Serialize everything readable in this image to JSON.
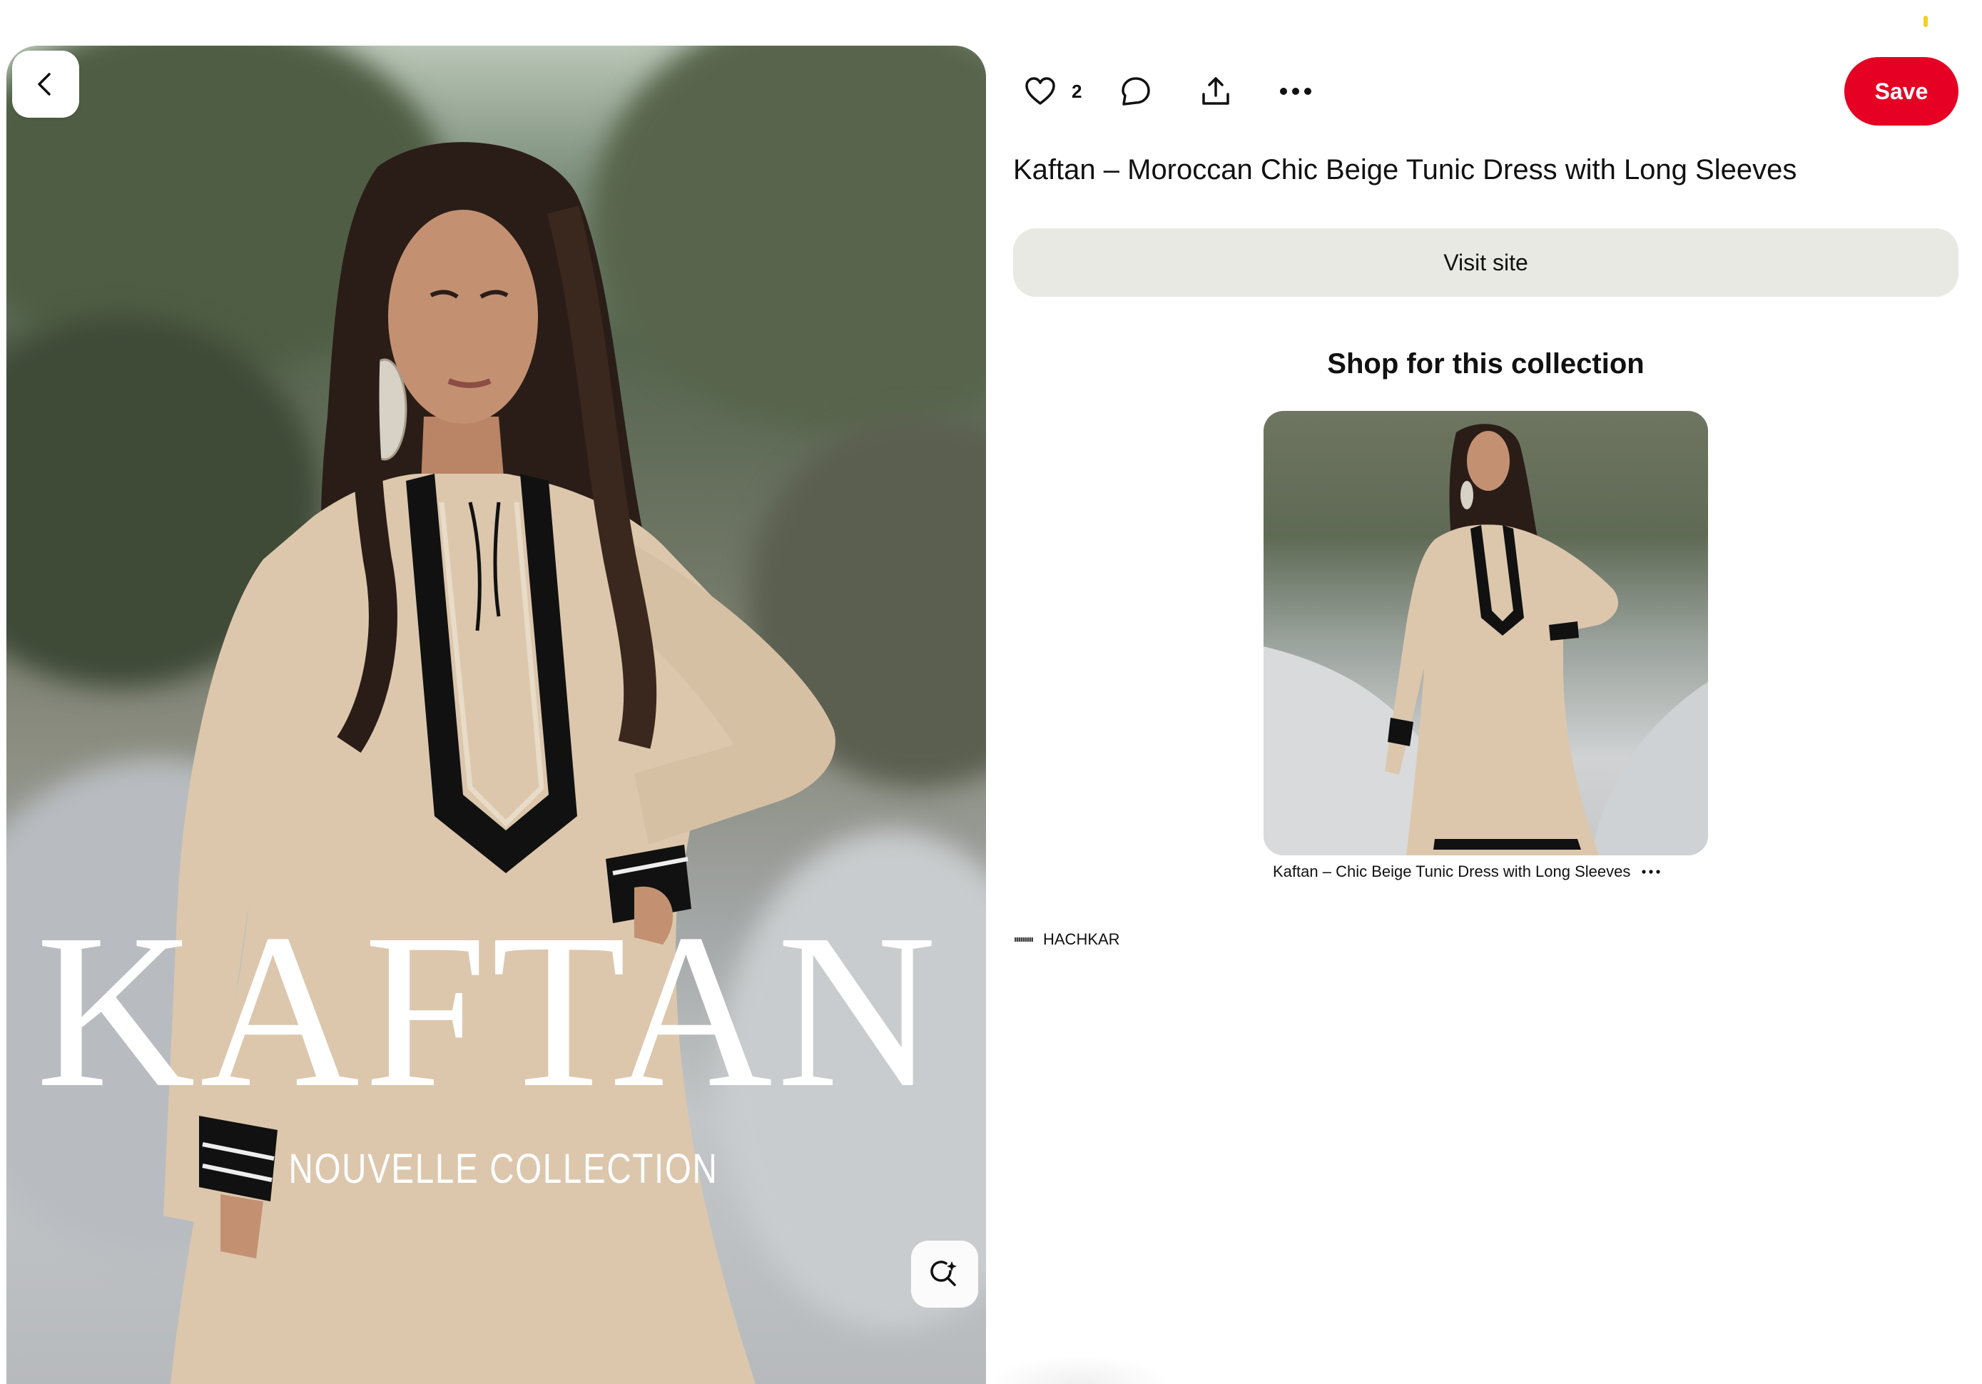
{
  "pin": {
    "overlay_title": "KAFTAN",
    "overlay_subtitle": "NOUVELLE COLLECTION",
    "title": "Kaftan – Moroccan Chic Beige Tunic Dress with Long Sleeves",
    "like_count": "2"
  },
  "actions": {
    "save_label": "Save",
    "visit_site_label": "Visit site"
  },
  "icons": {
    "back": "chevron-left-icon",
    "like": "heart-icon",
    "comment": "comment-icon",
    "share": "share-icon",
    "more": "more-icon",
    "visual_search": "visual-search-icon",
    "product_more": "more-icon"
  },
  "shop": {
    "heading": "Shop for this collection",
    "products": [
      {
        "title": "Kaftan – Chic Beige Tunic Dress with Long Sleeves"
      }
    ]
  },
  "source": {
    "name": "HACHKAR"
  },
  "colors": {
    "save_button": "#e60023",
    "visit_button": "#e9e9e4",
    "dress": "#dcc7ad",
    "trim": "#111111"
  }
}
